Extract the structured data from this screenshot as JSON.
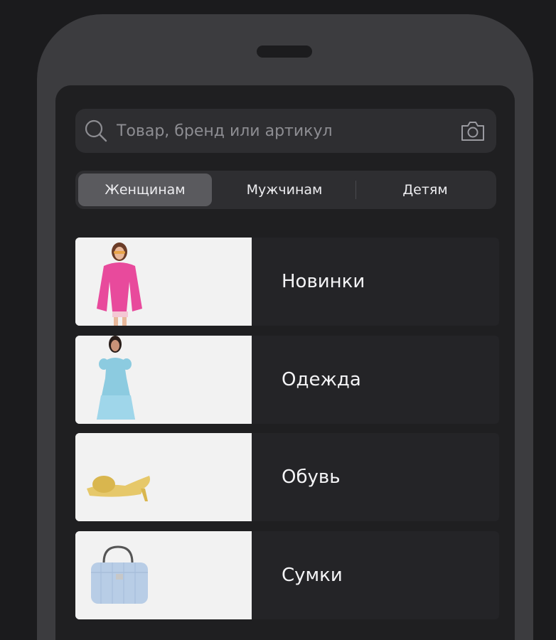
{
  "search": {
    "placeholder": "Товар, бренд или артикул",
    "icon": "search-icon",
    "camera_icon": "camera-icon"
  },
  "tabs": [
    {
      "label": "Женщинам",
      "active": true
    },
    {
      "label": "Мужчинам",
      "active": false
    },
    {
      "label": "Детям",
      "active": false
    }
  ],
  "categories": [
    {
      "label": "Новинки",
      "image": "woman-pink-jacket"
    },
    {
      "label": "Одежда",
      "image": "woman-blue-dress"
    },
    {
      "label": "Обувь",
      "image": "yellow-mule-shoe"
    },
    {
      "label": "Сумки",
      "image": "blue-quilted-handbag"
    }
  ],
  "colors": {
    "background": "#1b1b1d",
    "phone_frame": "#3c3c3f",
    "screen": "#1f1f21",
    "field": "#2e2e31",
    "active_tab": "#5a5a5e",
    "text": "#f4f4f6",
    "placeholder": "#8d8d92"
  }
}
